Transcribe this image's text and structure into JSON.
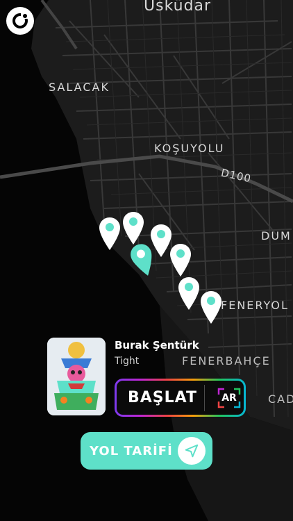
{
  "map": {
    "labels": {
      "uskudar": "Üsküdar",
      "salacak": "SALACAK",
      "kosuyolu": "KOŞUYOLU",
      "d100": "D100",
      "dum": "DUM",
      "feneryol": "FENERYOL",
      "fenerbahce": "FENERBAHÇE",
      "cad": "CAD"
    },
    "pin_color": "#5ee0c9",
    "pin_count": 7
  },
  "player": {
    "artist": "Burak Şentürk",
    "track": "Tight",
    "start_label": "BAŞLAT",
    "ar_label": "AR"
  },
  "directions": {
    "label": "YOL TARİFİ"
  },
  "colors": {
    "accent": "#5ee0c9",
    "background": "#000000"
  }
}
